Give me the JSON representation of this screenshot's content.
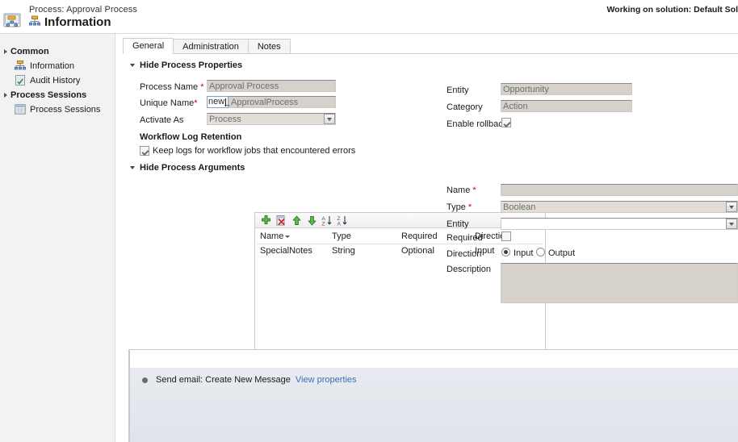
{
  "header": {
    "process_label": "Process: Approval Process",
    "page_title": "Information",
    "solution_note": "Working on solution: Default Sol",
    "icon": "process-window-icon",
    "title_icon": "process-node-icon"
  },
  "sidebar": {
    "groups": [
      {
        "label": "Common",
        "items": [
          {
            "label": "Information",
            "icon": "process-node-icon"
          },
          {
            "label": "Audit History",
            "icon": "audit-history-icon"
          }
        ]
      },
      {
        "label": "Process Sessions",
        "items": [
          {
            "label": "Process Sessions",
            "icon": "process-sessions-icon"
          }
        ]
      }
    ]
  },
  "tabs": [
    {
      "label": "General",
      "active": true
    },
    {
      "label": "Administration",
      "active": false
    },
    {
      "label": "Notes",
      "active": false
    }
  ],
  "process_properties": {
    "section_label": "Hide Process Properties",
    "left": {
      "process_name_label": "Process Name",
      "process_name_value": "Approval Process",
      "unique_name_label": "Unique Name",
      "unique_name_prefix": "new_",
      "unique_name_value": "ApprovalProcess",
      "activate_as_label": "Activate As",
      "activate_as_value": "Process"
    },
    "right": {
      "entity_label": "Entity",
      "entity_value": "Opportunity",
      "category_label": "Category",
      "category_value": "Action",
      "enable_rollback_label": "Enable rollback",
      "enable_rollback_checked": true
    },
    "log_retention": {
      "heading": "Workflow Log Retention",
      "checkbox_label": "Keep logs for workflow jobs that encountered errors",
      "checked": true
    }
  },
  "process_arguments": {
    "section_label": "Hide Process Arguments",
    "toolbar": [
      {
        "name": "add-argument-button",
        "icon": "green-plus-icon"
      },
      {
        "name": "delete-argument-button",
        "icon": "delete-document-icon"
      },
      {
        "name": "move-up-button",
        "icon": "green-up-arrow-icon"
      },
      {
        "name": "move-down-button",
        "icon": "green-down-arrow-icon"
      },
      {
        "name": "sort-ascending-button",
        "icon": "sort-az-icon"
      },
      {
        "name": "sort-descending-button",
        "icon": "sort-za-icon"
      }
    ],
    "columns": [
      "Name",
      "Type",
      "Required",
      "Direction"
    ],
    "sorted_column": "Name",
    "rows": [
      {
        "name": "SpecialNotes",
        "type": "String",
        "required": "Optional",
        "direction": "Input"
      }
    ],
    "detail": {
      "name_label": "Name",
      "name_value": "",
      "type_label": "Type",
      "type_value": "Boolean",
      "entity_label": "Entity",
      "entity_value": "",
      "required_label": "Required",
      "required_checked": false,
      "direction_label": "Direction",
      "direction_input_label": "Input",
      "direction_output_label": "Output",
      "direction_selected": "Input",
      "description_label": "Description",
      "description_value": ""
    }
  },
  "steps": {
    "items": [
      {
        "text": "Send email: Create New Message",
        "link": "View properties"
      }
    ]
  },
  "colors": {
    "accent_link": "#3b6fb6",
    "required_marker": "#d40000",
    "disabled_field": "#d6d2cb",
    "sidebar_bg": "#f2f2f2",
    "steps_bg": "#e4e9ef"
  }
}
